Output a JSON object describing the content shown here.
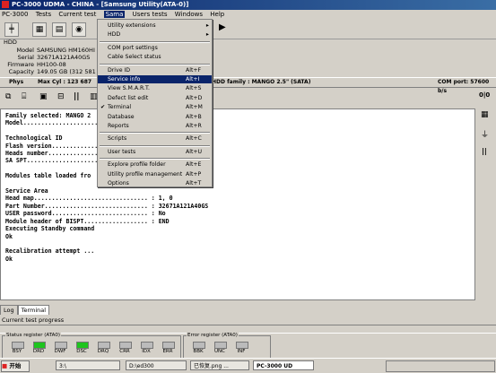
{
  "titlebar": {
    "title": "PC-3000 UDMA - CHINA - [Samsung Utility(ATA-0)]"
  },
  "menubar": {
    "items": [
      "PC-3000",
      "Tests",
      "Current test",
      "Sama",
      "Users tests",
      "Windows",
      "Help"
    ]
  },
  "dropdown": {
    "items": [
      {
        "label": "Utility extensions",
        "shortcut": "",
        "submenu": true
      },
      {
        "label": "HDD",
        "shortcut": "",
        "submenu": true
      },
      {
        "label": "COM port settings",
        "shortcut": ""
      },
      {
        "label": "Cable Select status",
        "shortcut": ""
      },
      {
        "label": "Drive ID",
        "shortcut": "Alt+F"
      },
      {
        "label": "Service info",
        "shortcut": "Alt+I",
        "highlight": true
      },
      {
        "label": "View S.M.A.R.T.",
        "shortcut": "Alt+S"
      },
      {
        "label": "Defect list edit",
        "shortcut": "Alt+D"
      },
      {
        "label": "Terminal",
        "shortcut": "Alt+M",
        "checked": true
      },
      {
        "label": "Database",
        "shortcut": "Alt+B"
      },
      {
        "label": "Reports",
        "shortcut": "Alt+R"
      },
      {
        "label": "Scripts",
        "shortcut": "Alt+C"
      },
      {
        "label": "User tests",
        "shortcut": "Alt+U"
      },
      {
        "label": "Explore profile folder",
        "shortcut": "Alt+E"
      },
      {
        "label": "Utility profile management",
        "shortcut": "Alt+P"
      },
      {
        "label": "Options",
        "shortcut": "Alt+T"
      }
    ]
  },
  "hdd": {
    "group": "HDD",
    "model_label": "Model",
    "model": "SAMSUNG HM160HI",
    "serial_label": "Serial",
    "serial": "32671A121A40GS",
    "firmware_label": "Firmware",
    "firmware": "HH100-08",
    "capacity_label": "Capacity",
    "capacity": "149.05 GB (312 581 808)",
    "family": "HDD family : MANGO 2.5\" (SATA)",
    "phys_label": "Phys",
    "max_cyl": "Max Cyl : 123 687",
    "com_port": "COM port: 57600 b/s"
  },
  "terminal_lines": [
    "Family selected: MANGO 2",
    "Model.....................",
    "",
    "Technological ID",
    "Flash version.............",
    "Heads number..............",
    "SA SPT....................",
    "",
    "Modules table loaded fro",
    "",
    "Service Area",
    "Head map................................ : 1, 0",
    "Part Number............................. : 32671A121A40GS",
    "USER password........................... : No",
    "Module header of BISPT.................. : END",
    "Executing Standby command",
    "Ok",
    "",
    "Recalibration attempt ...",
    "Ok"
  ],
  "tabs": [
    "Log",
    "Terminal"
  ],
  "progress_label": "Current test progress",
  "status_register": {
    "title": "Status register (ATA0)",
    "leds": [
      {
        "name": "BSY",
        "on": false
      },
      {
        "name": "DRD",
        "on": true
      },
      {
        "name": "DWF",
        "on": false
      },
      {
        "name": "DSC",
        "on": true
      },
      {
        "name": "DRQ",
        "on": false
      },
      {
        "name": "CRR",
        "on": false
      },
      {
        "name": "IDX",
        "on": false
      },
      {
        "name": "ERR",
        "on": false
      }
    ]
  },
  "error_register": {
    "title": "Error register (ATA0)",
    "leds": [
      {
        "name": "BBK",
        "on": false
      },
      {
        "name": "UNC",
        "on": false
      },
      {
        "name": "INF",
        "on": false
      }
    ]
  },
  "right_pane": {
    "io_label": "0|0"
  },
  "taskbar": {
    "start": "开始",
    "tasks": [
      {
        "label": "3:\\",
        "active": false
      },
      {
        "label": "D:\\ed300",
        "active": false
      },
      {
        "label": "已恢复.png ...",
        "active": false
      },
      {
        "label": "PC-3000 UD",
        "active": true
      }
    ]
  },
  "colors": {
    "titlebar": "#0a246a",
    "led_on": "#1ec41e",
    "menu_highlight": "#0a246a"
  }
}
